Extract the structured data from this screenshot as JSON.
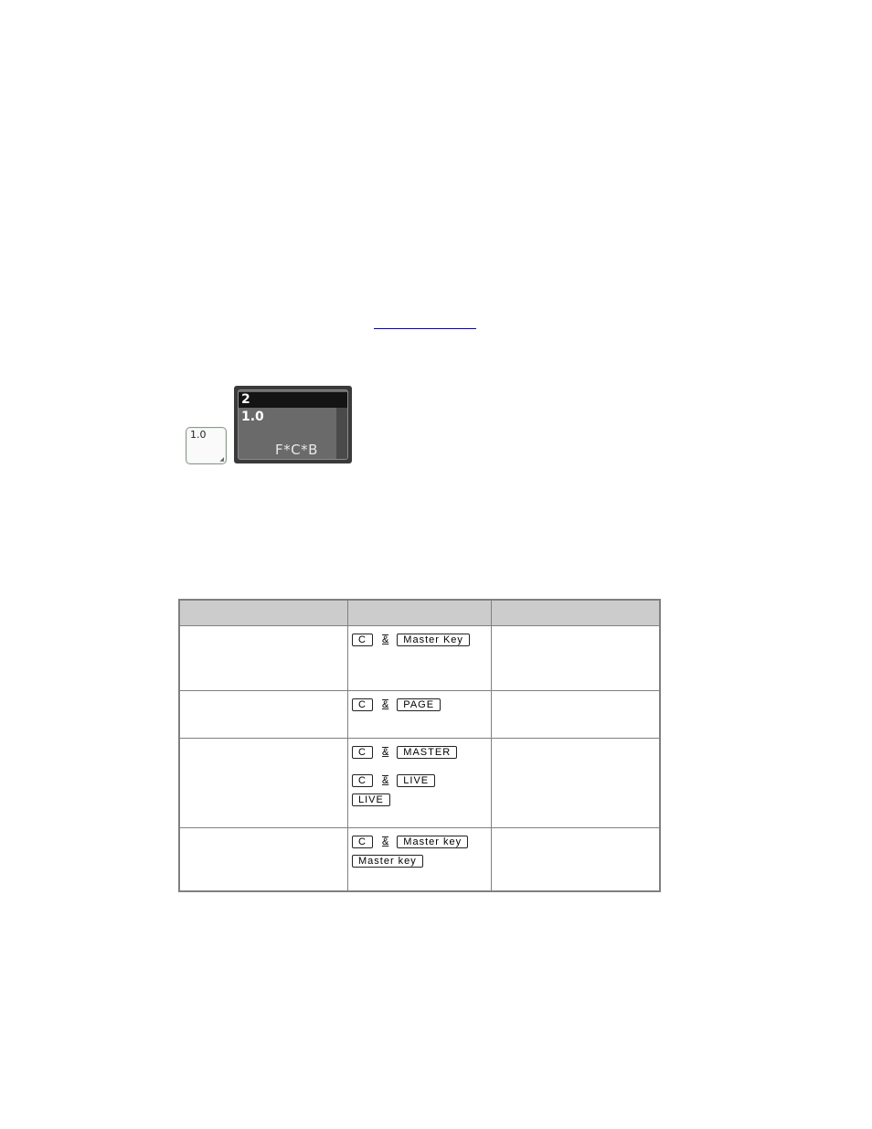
{
  "link": {
    "text": "",
    "color": "#0000cc"
  },
  "fader_key": {
    "value": "1.0"
  },
  "playback_display": {
    "number": "2",
    "level": "1.0",
    "name": "F*C*B"
  },
  "table": {
    "headers": [
      "",
      "",
      ""
    ],
    "rows": [
      {
        "description": "",
        "keys": [
          [
            "C",
            "&",
            "Master Key"
          ]
        ],
        "notes": ""
      },
      {
        "description": "",
        "keys": [
          [
            "C",
            "&",
            "PAGE"
          ]
        ],
        "notes": ""
      },
      {
        "description": "",
        "keys": [
          [
            "C",
            "&",
            "MASTER"
          ],
          [
            "C",
            "&",
            "LIVE"
          ],
          [
            "LIVE"
          ]
        ],
        "notes": ""
      },
      {
        "description": "",
        "keys": [
          [
            "C",
            "&",
            "Master key"
          ],
          [
            "Master key"
          ]
        ],
        "notes": ""
      }
    ]
  }
}
